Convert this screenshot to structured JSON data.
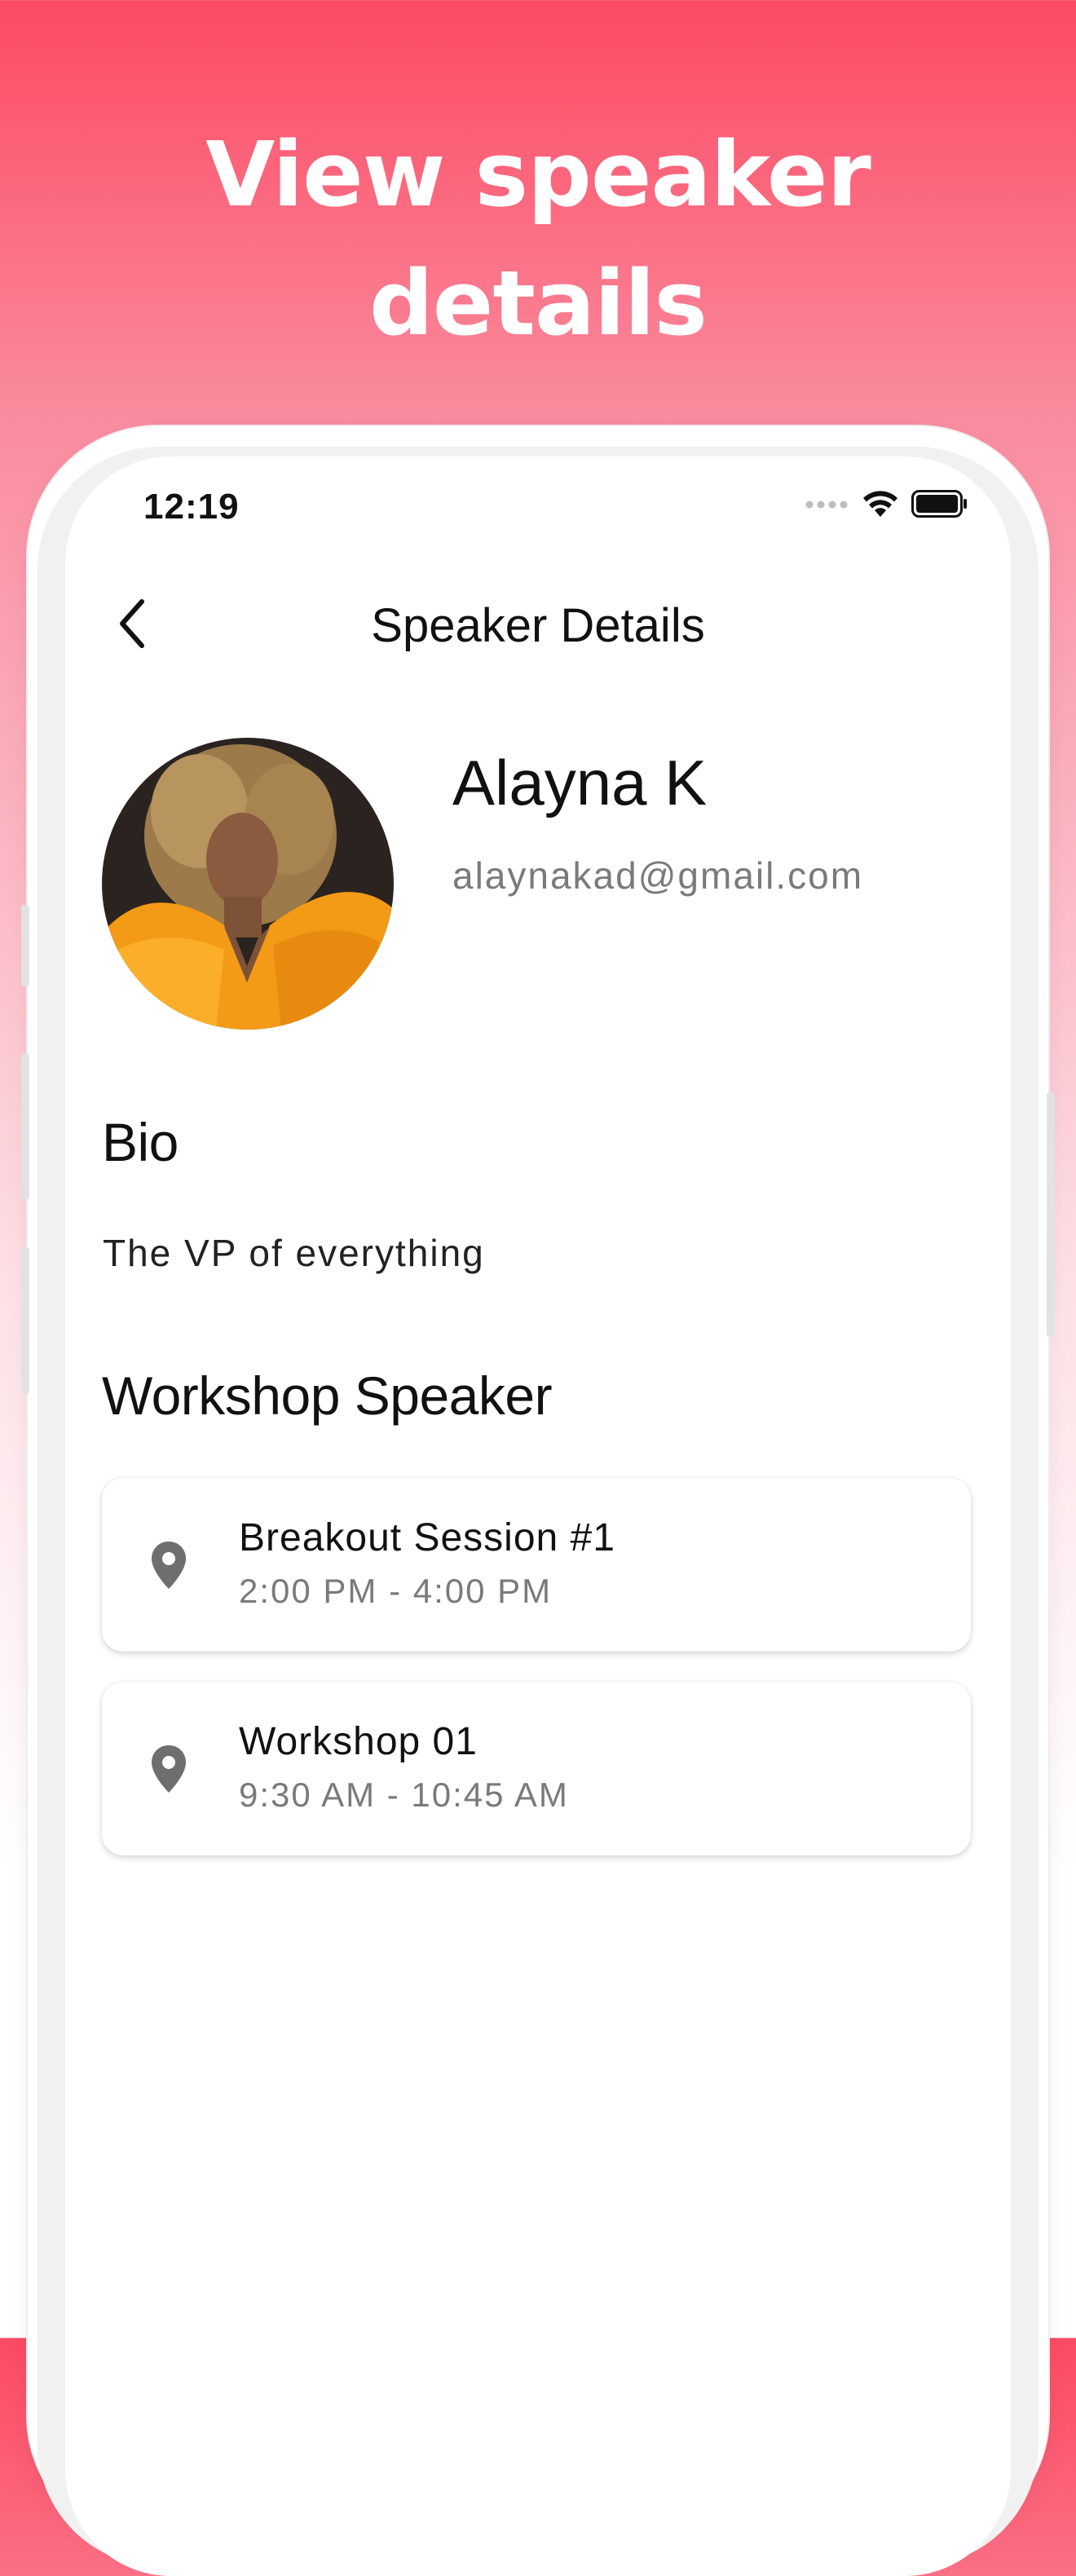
{
  "headline": {
    "line1": "View speaker",
    "line2": "details"
  },
  "status_bar": {
    "time": "12:19"
  },
  "nav": {
    "title": "Speaker Details",
    "back_icon": "chevron-left-icon"
  },
  "speaker": {
    "name": "Alayna K",
    "email": "alaynakad@gmail.com"
  },
  "bio": {
    "heading": "Bio",
    "text": "The VP of everything"
  },
  "workshop": {
    "heading": "Workshop Speaker",
    "sessions": [
      {
        "title": "Breakout Session #1",
        "time": "2:00 PM - 4:00 PM",
        "icon": "location-pin-icon"
      },
      {
        "title": "Workshop 01",
        "time": "9:30 AM - 10:45 AM",
        "icon": "location-pin-icon"
      }
    ]
  },
  "colors": {
    "gradient_top": "#FC4A63",
    "text_primary": "#111111",
    "text_secondary": "#7A7A7A",
    "icon_gray": "#6E6E6E"
  }
}
